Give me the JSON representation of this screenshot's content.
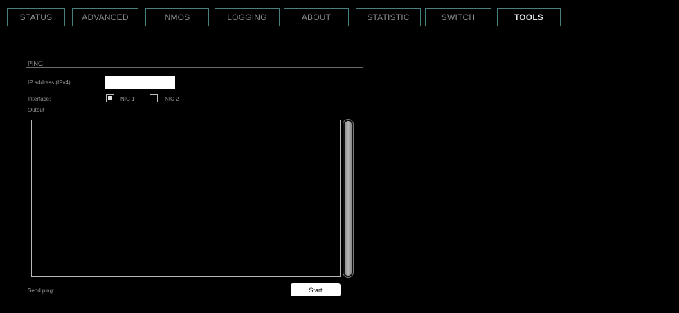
{
  "tabs": [
    {
      "label": "STATUS",
      "active": false
    },
    {
      "label": "ADVANCED",
      "active": false
    },
    {
      "label": "NMOS",
      "active": false
    },
    {
      "label": "LOGGING",
      "active": false
    },
    {
      "label": "ABOUT",
      "active": false
    },
    {
      "label": "STATISTIC",
      "active": false
    },
    {
      "label": "SWITCH",
      "active": false
    },
    {
      "label": "TOOLS",
      "active": true
    }
  ],
  "ping": {
    "title": "PING",
    "ip_label": "IP address (IPv4):",
    "ip_value": "",
    "interface_label": "Interface:",
    "nic1_label": "NIC 1",
    "nic1_checked": true,
    "nic2_label": "NIC 2",
    "nic2_checked": false,
    "output_label": "Output",
    "output_text": "",
    "send_label": "Send ping:",
    "start_label": "Start"
  },
  "colors": {
    "tab_border": "#4a7f80",
    "background": "#000000",
    "text": "#9a9a9a"
  }
}
